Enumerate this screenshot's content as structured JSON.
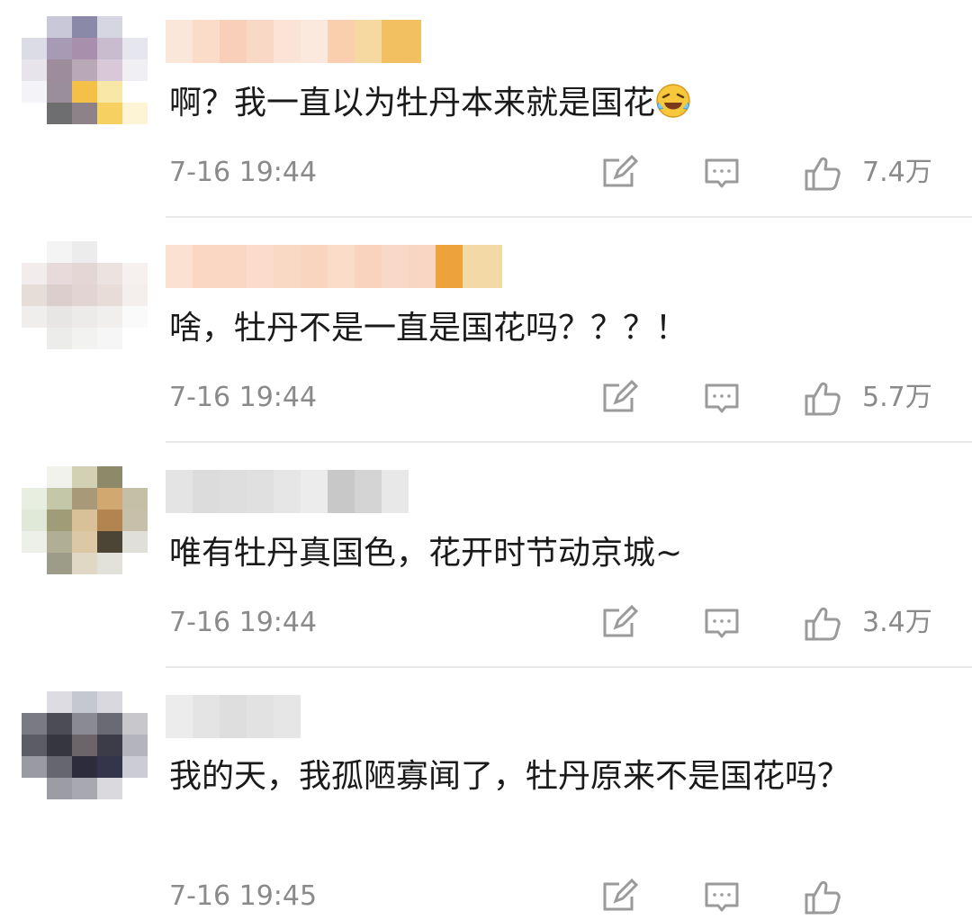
{
  "comments": [
    {
      "text": "啊？我一直以为牡丹本来就是国花",
      "emoji": "laughing-crying-emoji",
      "time": "7-16 19:44",
      "likes": "7.4万",
      "avatar_colors": [
        "#ffffff",
        "#c8c8d8",
        "#8a8aa8",
        "#d6d6e2",
        "#ffffff",
        "#dcdce6",
        "#a79ab4",
        "#a890ac",
        "#c8bcce",
        "#e6e6ee",
        "#e8e4ec",
        "#9c8c9c",
        "#b8a8b8",
        "#d8c8d8",
        "#f0f0f4",
        "#f4f4f8",
        "#9a8e9a",
        "#f4c048",
        "#f8e8a8",
        "#ffffff",
        "#ffffff",
        "#6e6e70",
        "#8c8288",
        "#f6d060",
        "#fcf4d4"
      ],
      "name_colors": [
        "#fae7da",
        "#fbdcc8",
        "#f8cfb8",
        "#fad8c6",
        "#fbe3d6",
        "#fce9de",
        "#f9cfb0",
        "#f6d9a0",
        "#f2c060"
      ]
    },
    {
      "text": "啥，牡丹不是一直是国花吗？？？！",
      "emoji": "",
      "time": "7-16 19:44",
      "likes": "5.7万",
      "avatar_colors": [
        "#ffffff",
        "#f4f4f4",
        "#ececec",
        "#ffffff",
        "#ffffff",
        "#f2ecec",
        "#e8dada",
        "#e4d6d4",
        "#ece2e0",
        "#f6f0ee",
        "#e6dcd8",
        "#dccecc",
        "#e2d4d2",
        "#e8dcd8",
        "#f4eeec",
        "#f0eeec",
        "#e8e6e4",
        "#ecebea",
        "#f0efee",
        "#fafafa",
        "#ffffff",
        "#ececea",
        "#f2f2f0",
        "#f6f6f6",
        "#ffffff"
      ],
      "name_colors": [
        "#fbe1d1",
        "#f9d7c2",
        "#f9d7c2",
        "#fbdccb",
        "#f9d8c4",
        "#f9d5bf",
        "#fbdcc9",
        "#f9d3bd",
        "#fad8c7",
        "#f9d6c4",
        "#eda23c",
        "#f3d9a6"
      ]
    },
    {
      "text": "唯有牡丹真国色，花开时节动京城~",
      "emoji": "",
      "time": "7-16 19:44",
      "likes": "3.4万",
      "avatar_colors": [
        "#ffffff",
        "#f2f2ec",
        "#d4d0b4",
        "#8c8a68",
        "#ffffff",
        "#e8eee0",
        "#c4c8a8",
        "#a89a78",
        "#d0a870",
        "#c4c0a8",
        "#e0e8d8",
        "#a09c78",
        "#d8c098",
        "#b48450",
        "#c6c0aa",
        "#ecf0e8",
        "#b0ae94",
        "#dcc8a4",
        "#4c4434",
        "#e0e0d8",
        "#ffffff",
        "#9c9c88",
        "#e0d8c4",
        "#e2e2da",
        "#ffffff"
      ],
      "name_colors": [
        "#e4e4e4",
        "#dcdcdc",
        "#dedede",
        "#e0e0e0",
        "#e6e6e6",
        "#ececec",
        "#c8c8c8",
        "#d4d4d4",
        "#e8e8e8"
      ]
    },
    {
      "text": "我的天，我孤陋寡闻了，牡丹原来不是国花吗？",
      "emoji": "",
      "time": "7-16 19:45",
      "likes": "",
      "avatar_colors": [
        "#ffffff",
        "#dcdce2",
        "#c6c8d0",
        "#d8d8de",
        "#ffffff",
        "#7a7a84",
        "#4c4c56",
        "#8a8a92",
        "#6a6a74",
        "#c8c8cc",
        "#5c5c66",
        "#363640",
        "#6c6468",
        "#3c3c48",
        "#b4b4bc",
        "#9a9aa2",
        "#666670",
        "#2c2c3c",
        "#34344a",
        "#ccccd4",
        "#ffffff",
        "#9c9ca4",
        "#a8a8b0",
        "#dadade",
        "#ffffff"
      ],
      "name_colors": [
        "#ececec",
        "#e4e4e4",
        "#dedede",
        "#e2e2e2",
        "#e6e6e6"
      ]
    }
  ],
  "icons": {
    "edit": "edit-icon",
    "reply": "comment-icon",
    "like": "thumbs-up-icon"
  }
}
